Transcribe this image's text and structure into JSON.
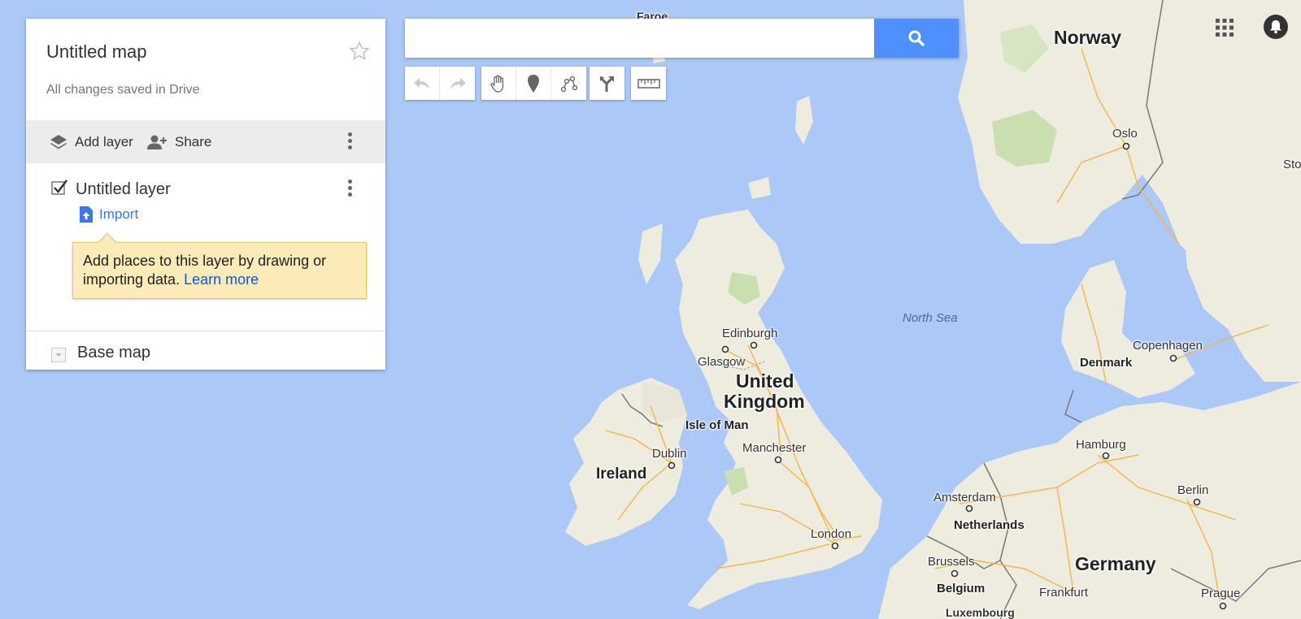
{
  "panel": {
    "map_title": "Untitled map",
    "saved_status": "All changes saved in Drive",
    "add_layer_label": "Add layer",
    "share_label": "Share",
    "layer": {
      "name": "Untitled layer",
      "checked": true,
      "import_label": "Import"
    },
    "tooltip": {
      "text": "Add places to this layer by drawing or importing data. ",
      "link": "Learn more"
    },
    "base_map_label": "Base map"
  },
  "search": {
    "placeholder": "",
    "value": ""
  },
  "tools": [
    "undo-icon",
    "redo-icon",
    "hand-icon",
    "marker-icon",
    "line-icon",
    "directions-icon",
    "ruler-icon"
  ],
  "map": {
    "labels": {
      "faroe": "Faroe",
      "norway": "Norway",
      "oslo": "Oslo",
      "sto": "Sto",
      "north_sea": "North Sea",
      "edinburgh": "Edinburgh",
      "glasgow": "Glasgow",
      "united": "United",
      "kingdom": "Kingdom",
      "isle_of_man": "Isle of Man",
      "ireland": "Ireland",
      "dublin": "Dublin",
      "manchester": "Manchester",
      "london": "London",
      "denmark": "Denmark",
      "copenhagen": "Copenhagen",
      "hamburg": "Hamburg",
      "amsterdam": "Amsterdam",
      "netherlands": "Netherlands",
      "brussels": "Brussels",
      "belgium": "Belgium",
      "luxembourg": "Luxembourg",
      "germany": "Germany",
      "berlin": "Berlin",
      "frankfurt": "Frankfurt",
      "prague": "Prague"
    }
  },
  "colors": {
    "sea": "#abc8f6",
    "land": "#eeecdf",
    "park": "#c9dfaf",
    "road": "#f7b24a",
    "accent": "#4d90fe",
    "link": "#1a56c8",
    "tooltip_bg": "#faebb8"
  }
}
